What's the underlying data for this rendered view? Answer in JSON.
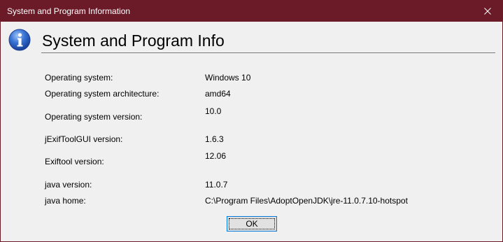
{
  "window": {
    "title": "System and Program Information",
    "close_icon": "close-icon"
  },
  "header": {
    "icon": "info-icon",
    "heading": "System and Program Info"
  },
  "info": {
    "rows": [
      {
        "label": "Operating system:",
        "value": "Windows 10"
      },
      {
        "label": "Operating system architecture:",
        "value": "amd64"
      },
      {
        "label": "Operating system version:",
        "value": "10.0"
      },
      {
        "label": "jExifToolGUI version:",
        "value": "1.6.3"
      },
      {
        "label": "Exiftool version:",
        "value": "12.06"
      },
      {
        "label": "java version:",
        "value": "11.0.7"
      },
      {
        "label": "java home:",
        "value": "C:\\Program Files\\AdoptOpenJDK\\jre-11.0.7.10-hotspot"
      }
    ]
  },
  "actions": {
    "ok_label": "OK"
  },
  "colors": {
    "titlebar": "#6b1a28",
    "dialog_background": "#f0f0f0",
    "button_focus_border": "#0078d7"
  }
}
